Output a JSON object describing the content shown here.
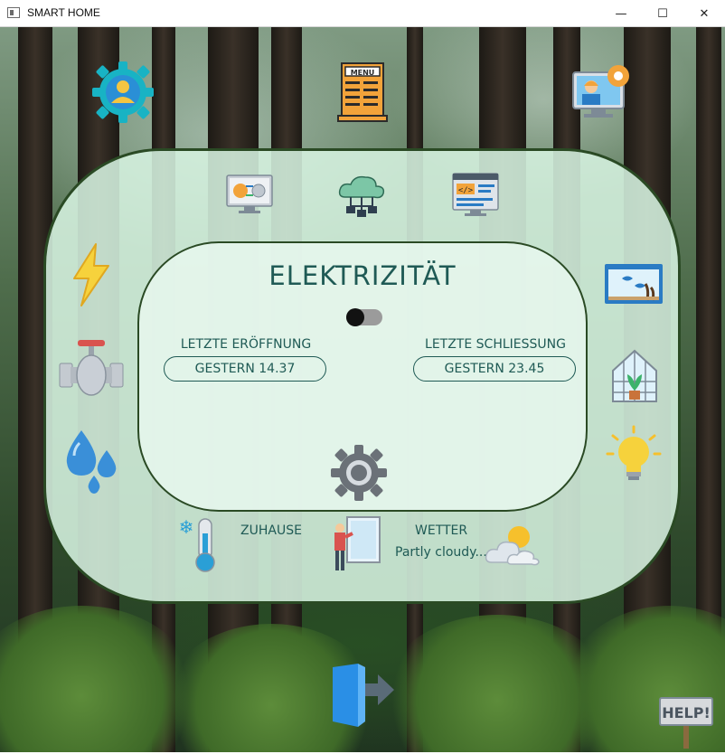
{
  "window": {
    "title": "SMART HOME",
    "minimize": "—",
    "maximize": "☐",
    "close": "✕"
  },
  "main": {
    "heading": "ELEKTRIZITÄT",
    "toggle_on": false,
    "last_opening": {
      "label": "LETZTE ERÖFFNUNG",
      "value": "GESTERN  14.37"
    },
    "last_closing": {
      "label": "LETZTE SCHLIESSUNG",
      "value": "GESTERN 23.45"
    }
  },
  "bottom": {
    "home_label": "ZUHAUSE",
    "weather_label": "WETTER",
    "weather_value": "Partly cloudy..."
  },
  "menu_icon_text": "MENU",
  "help_sign_text": "HELP!",
  "colors": {
    "accent_text": "#1f5a55",
    "panel_border": "#2a4a24",
    "panel_fill": "#d6f2e0"
  }
}
